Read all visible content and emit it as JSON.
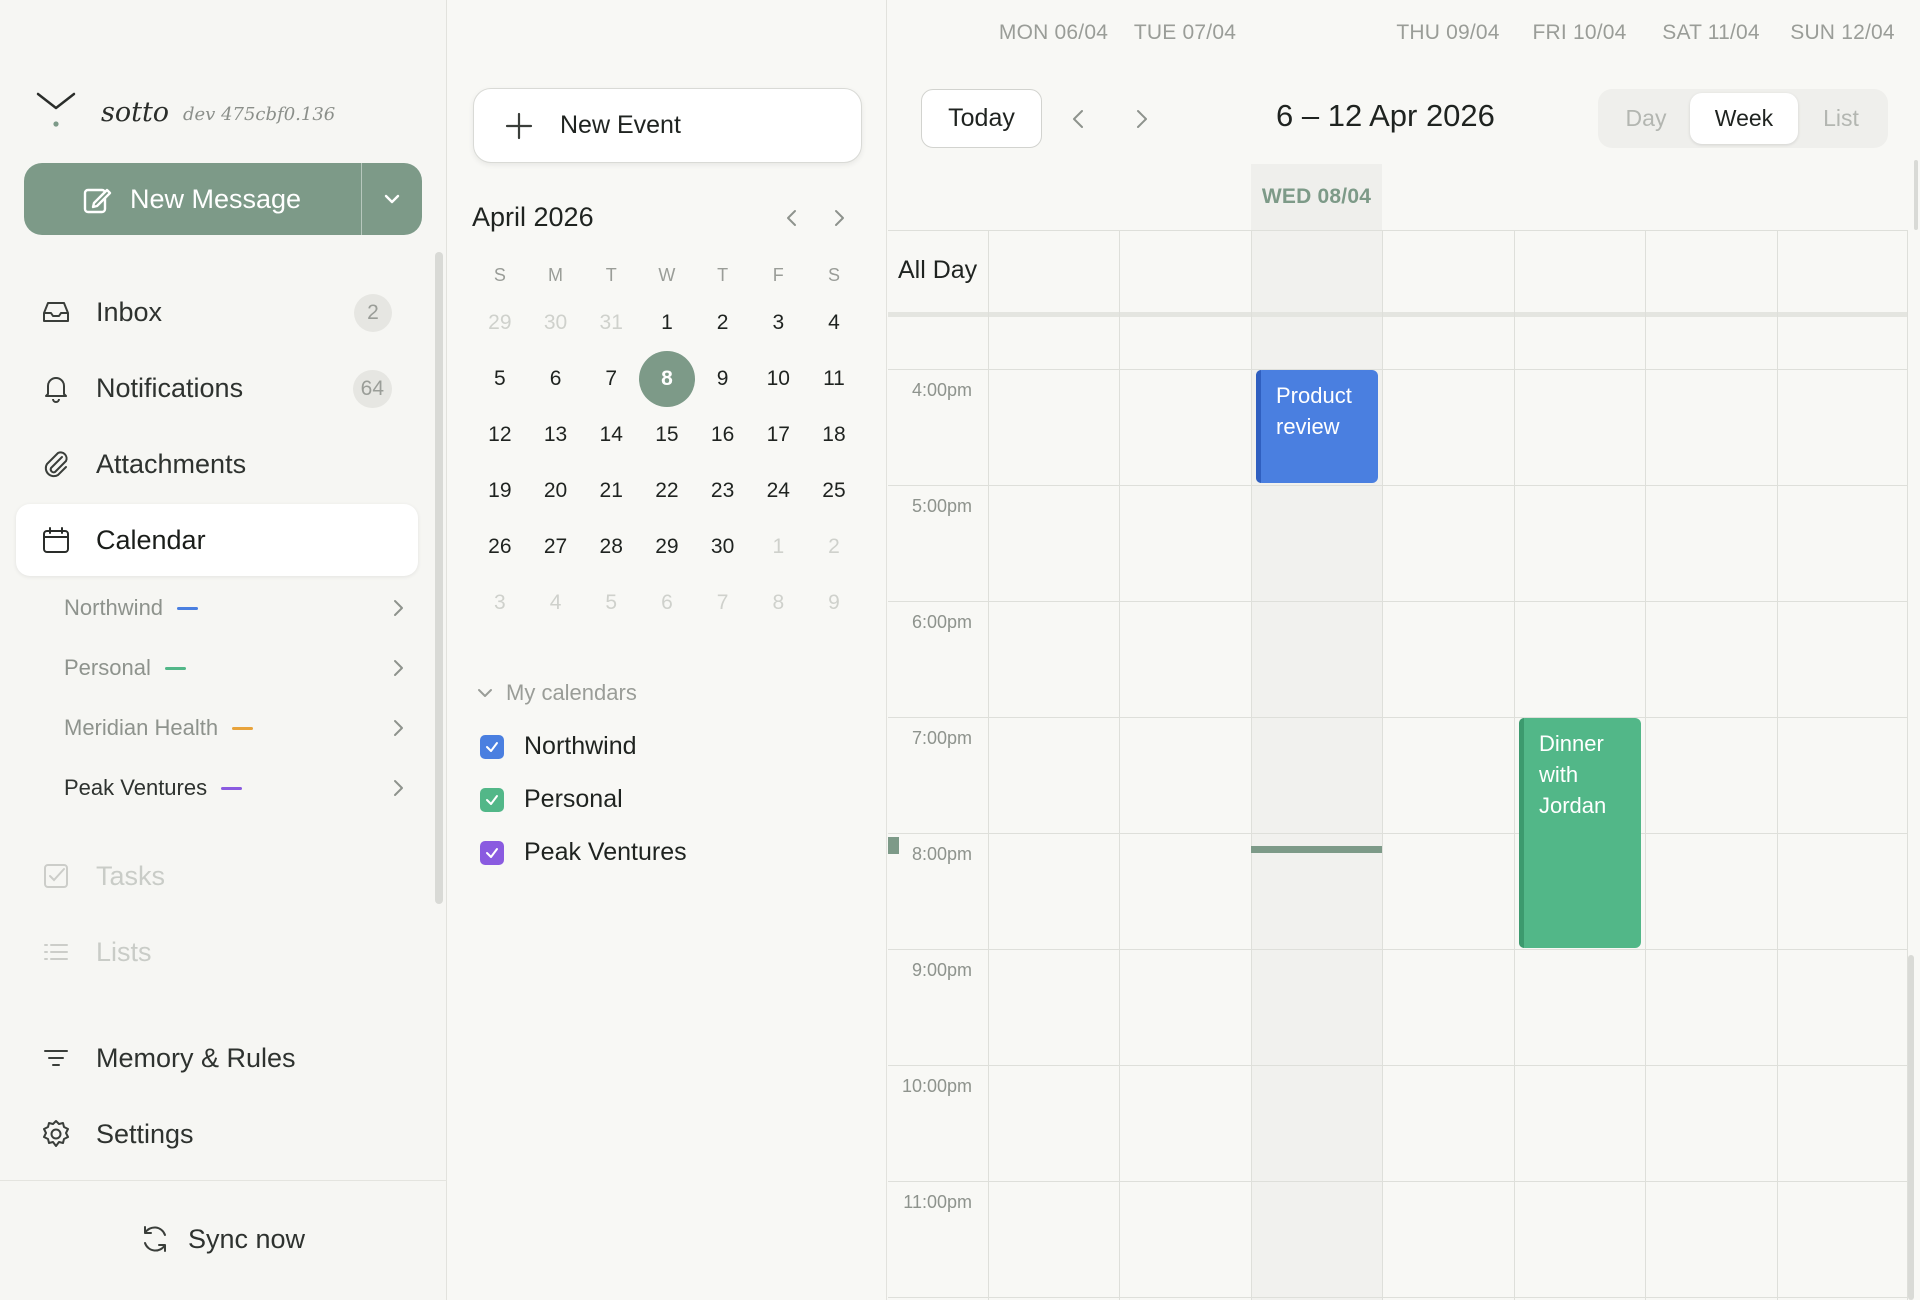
{
  "app": {
    "name": "sotto",
    "version": "dev 475cbf0.136"
  },
  "compose": {
    "label": "New Message"
  },
  "nav": {
    "inbox": {
      "label": "Inbox",
      "badge": "2"
    },
    "notifications": {
      "label": "Notifications",
      "badge": "64"
    },
    "attachments": {
      "label": "Attachments"
    },
    "calendar": {
      "label": "Calendar"
    },
    "tasks": {
      "label": "Tasks"
    },
    "lists": {
      "label": "Lists"
    },
    "memory": {
      "label": "Memory & Rules"
    },
    "settings": {
      "label": "Settings"
    },
    "sync": {
      "label": "Sync now"
    }
  },
  "calendar_accounts": [
    {
      "label": "Northwind",
      "color": "#4a7fe0"
    },
    {
      "label": "Personal",
      "color": "#52b788"
    },
    {
      "label": "Meridian Health",
      "color": "#e8a33b"
    },
    {
      "label": "Peak Ventures",
      "color": "#8a5be0"
    }
  ],
  "mini_calendar": {
    "title": "April 2026",
    "weekdays": [
      "S",
      "M",
      "T",
      "W",
      "T",
      "F",
      "S"
    ],
    "weeks": [
      [
        "29",
        "30",
        "31",
        "1",
        "2",
        "3",
        "4"
      ],
      [
        "5",
        "6",
        "7",
        "8",
        "9",
        "10",
        "11"
      ],
      [
        "12",
        "13",
        "14",
        "15",
        "16",
        "17",
        "18"
      ],
      [
        "19",
        "20",
        "21",
        "22",
        "23",
        "24",
        "25"
      ],
      [
        "26",
        "27",
        "28",
        "29",
        "30",
        "1",
        "2"
      ],
      [
        "3",
        "4",
        "5",
        "6",
        "7",
        "8",
        "9"
      ]
    ],
    "selected_day": "8"
  },
  "new_event": {
    "label": "New Event"
  },
  "my_calendars": {
    "label": "My calendars",
    "items": [
      {
        "label": "Northwind",
        "color": "#4a7fe0",
        "checked": true
      },
      {
        "label": "Personal",
        "color": "#52b788",
        "checked": true
      },
      {
        "label": "Peak Ventures",
        "color": "#8a5be0",
        "checked": true
      }
    ]
  },
  "toolbar": {
    "today": "Today",
    "range": "6 – 12 Apr 2026",
    "views": [
      "Day",
      "Week",
      "List"
    ],
    "active_view": "Week"
  },
  "week": {
    "days": [
      "MON 06/04",
      "TUE 07/04",
      "WED 08/04",
      "THU 09/04",
      "FRI 10/04",
      "SAT 11/04",
      "SUN 12/04"
    ],
    "today_index": 2,
    "all_day_label": "All Day",
    "times": [
      "4:00pm",
      "5:00pm",
      "6:00pm",
      "7:00pm",
      "8:00pm",
      "9:00pm",
      "10:00pm",
      "11:00pm"
    ]
  },
  "events": [
    {
      "title": "Product review",
      "day": "WED 08/04",
      "start": "4:00pm",
      "end": "5:00pm",
      "color": "#4a7fe0",
      "calendar": "Northwind"
    },
    {
      "title": "Dinner with Jordan",
      "day": "FRI 10/04",
      "start": "7:00pm",
      "end": "9:00pm",
      "color": "#52b788",
      "calendar": "Personal"
    }
  ]
}
